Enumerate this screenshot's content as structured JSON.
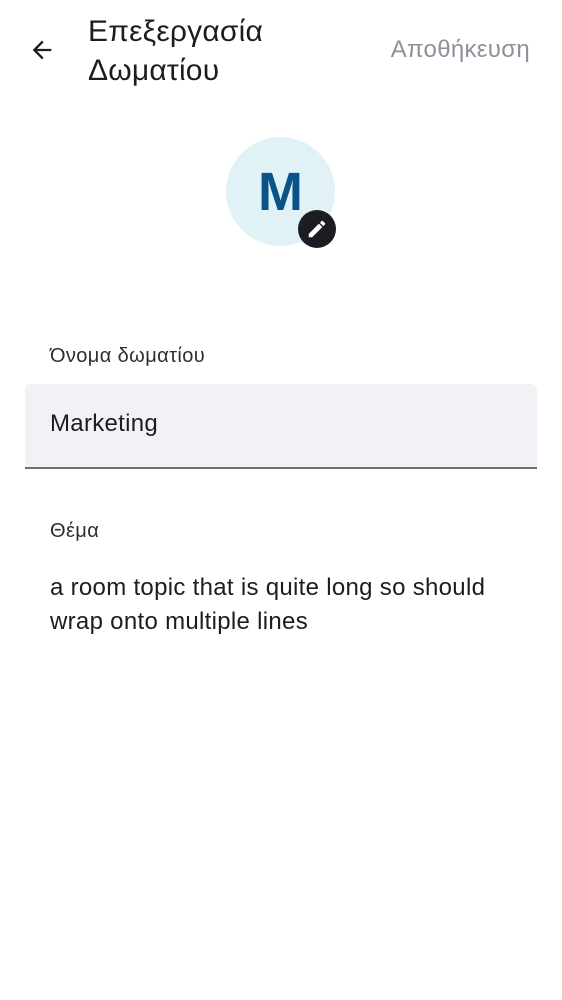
{
  "header": {
    "title": "Επεξεργασία Δωματίου",
    "save_label": "Αποθήκευση",
    "back_icon": "arrow-left-icon"
  },
  "avatar": {
    "initial": "M",
    "background_color": "#e1f2f7",
    "initial_color": "#0b5289",
    "edit_icon": "pencil-icon"
  },
  "form": {
    "room_name": {
      "label": "Όνομα δωματίου",
      "value": "Marketing"
    },
    "topic": {
      "label": "Θέμα",
      "value": "a room topic that is quite long so should wrap onto multiple lines"
    }
  }
}
